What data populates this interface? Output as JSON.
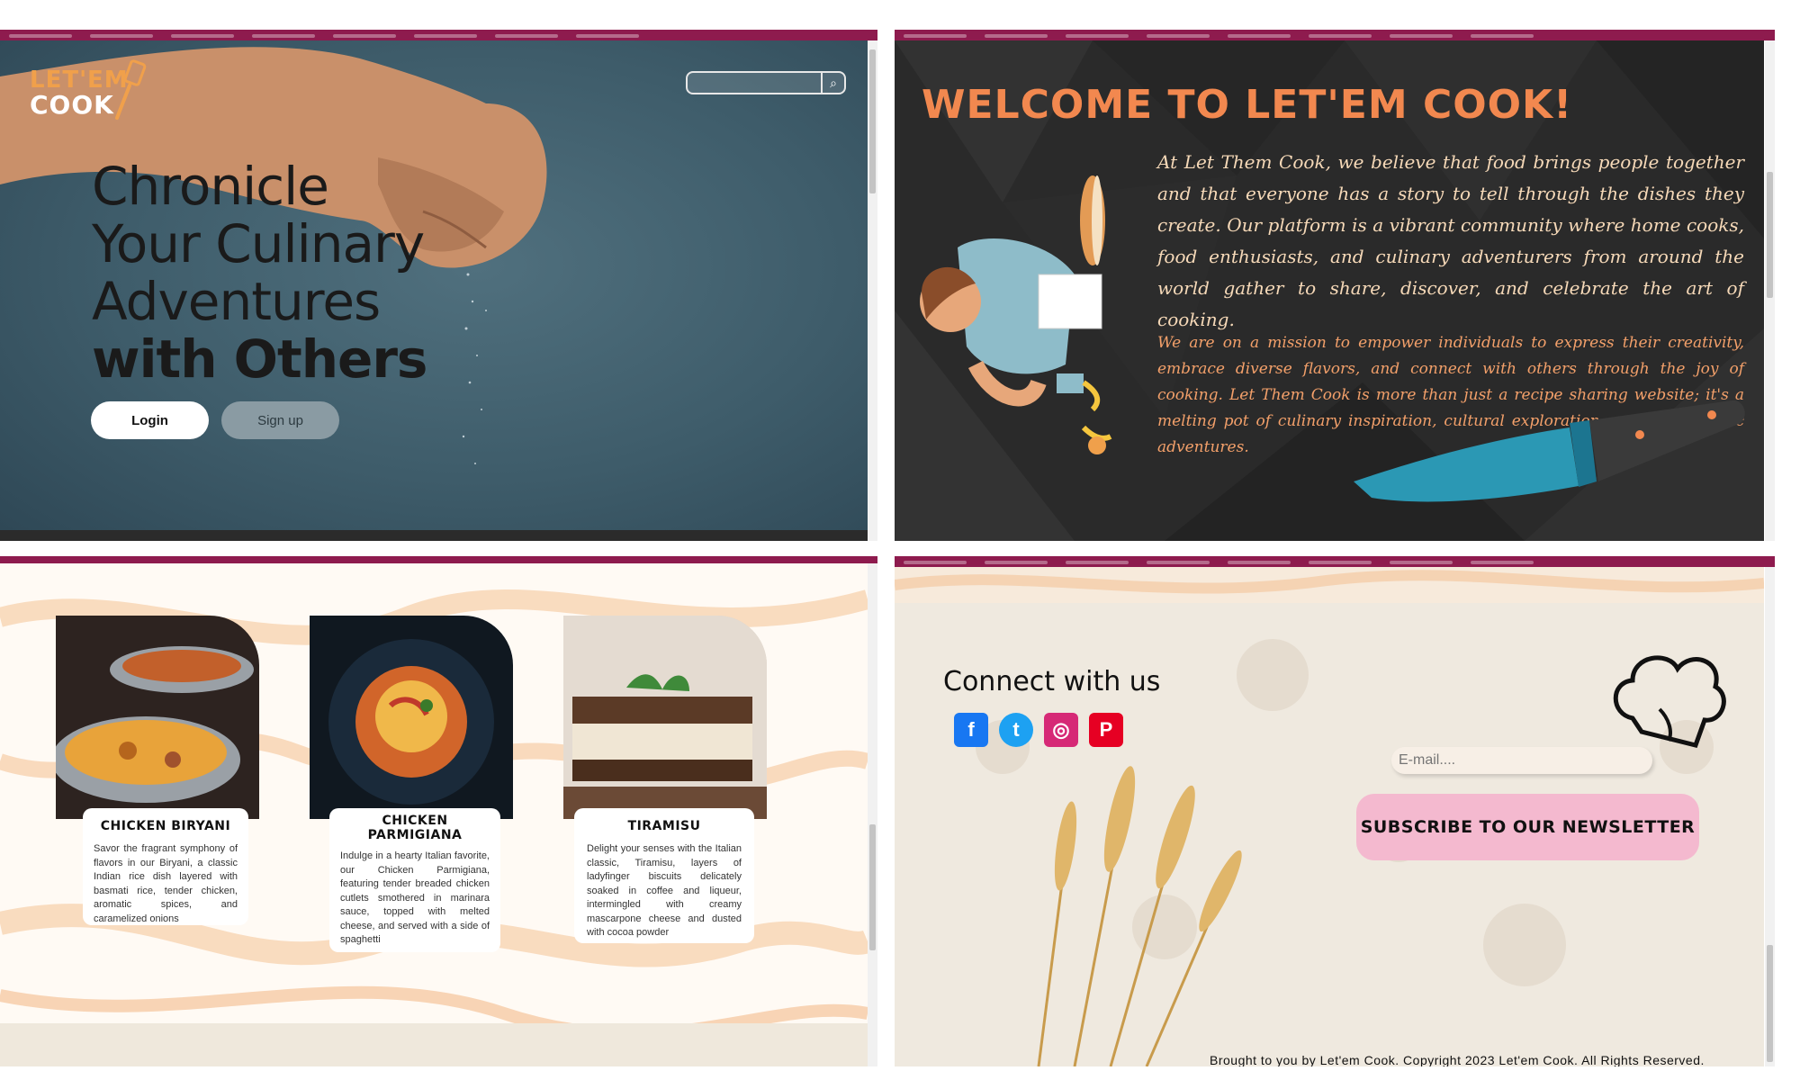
{
  "hero": {
    "logo_line1": "LET'EM",
    "logo_line2": "COOK",
    "search_placeholder": "",
    "title_line1": "Chronicle",
    "title_line2": "Your Culinary",
    "title_line3": "Adventures",
    "title_line4": "with Others",
    "login_label": "Login",
    "signup_label": "Sign up"
  },
  "about": {
    "title": "WELCOME TO LET'EM COOK!",
    "paragraph1": "At Let Them Cook, we believe that food brings people together and that everyone has a story to tell through the dishes they create. Our platform is a vibrant community where home cooks, food enthusiasts, and culinary adventurers from around the world gather to share, discover, and celebrate the art of cooking.",
    "paragraph2": "We are on a mission to empower individuals to express their creativity, embrace diverse flavors, and connect with others through the joy of cooking. Let Them Cook is more than just a recipe sharing website; it's a melting pot of culinary inspiration, cultural exploration, and gastronomic adventures."
  },
  "recipes": [
    {
      "title": "CHICKEN BIRYANI",
      "description": "Savor the fragrant symphony of flavors in our Biryani, a classic Indian rice dish layered with basmati rice, tender chicken, aromatic spices, and caramelized onions"
    },
    {
      "title": "CHICKEN PARMIGIANA",
      "description": "Indulge in a hearty Italian favorite, our Chicken Parmigiana, featuring tender breaded chicken cutlets smothered in marinara sauce, topped with melted cheese, and served with a side of spaghetti"
    },
    {
      "title": "TIRAMISU",
      "description": "Delight your senses with the Italian classic, Tiramisu, layers of ladyfinger biscuits delicately soaked in coffee and liqueur, intermingled with creamy mascarpone cheese and dusted with cocoa powder"
    }
  ],
  "footer": {
    "connect_title": "Connect with us",
    "social": [
      {
        "name": "facebook-icon",
        "glyph": "f",
        "color": "#1877f2"
      },
      {
        "name": "twitter-icon",
        "glyph": "t",
        "color": "#1da1f2"
      },
      {
        "name": "instagram-icon",
        "glyph": "◎",
        "color": "#d62976"
      },
      {
        "name": "pinterest-icon",
        "glyph": "P",
        "color": "#e60023"
      }
    ],
    "email_placeholder": "E-mail....",
    "subscribe_label": "SUBSCRIBE TO OUR NEWSLETTER",
    "copyright": "Brought to you by Let'em Cook. Copyright 2023  Let'em Cook. All Rights Reserved."
  },
  "colors": {
    "bookmark_bar": "#8e1b4e",
    "accent_orange": "#f2884f",
    "subscribe_pink": "#f4b9cf"
  }
}
